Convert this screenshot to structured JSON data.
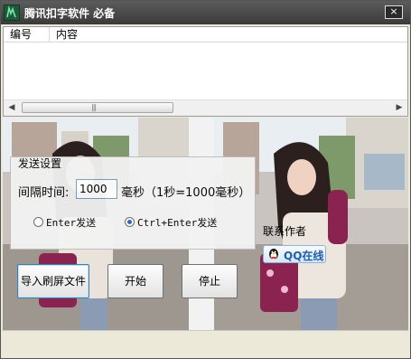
{
  "window": {
    "title": "腾讯扣字软件 必备",
    "close_label": "×"
  },
  "list": {
    "columns": [
      "编号",
      "内容"
    ],
    "scroll_grip": "|||"
  },
  "settings": {
    "group_title": "发送设置",
    "interval_label": "间隔时间:",
    "interval_value": "1000",
    "unit_label": "毫秒（1秒=1000毫秒）",
    "radio_enter": "Enter发送",
    "radio_ctrl_enter": "Ctrl+Enter发送",
    "selected": "ctrl_enter"
  },
  "buttons": {
    "import": "导入刷屏文件",
    "start": "开始",
    "stop": "停止"
  },
  "contact": {
    "label": "联系作者",
    "qq_label": "QQ在线"
  },
  "colors": {
    "titlebar": "#3a3a3a",
    "qq_blue": "#1d5fb0",
    "accent_focus": "#3c7fb1"
  }
}
